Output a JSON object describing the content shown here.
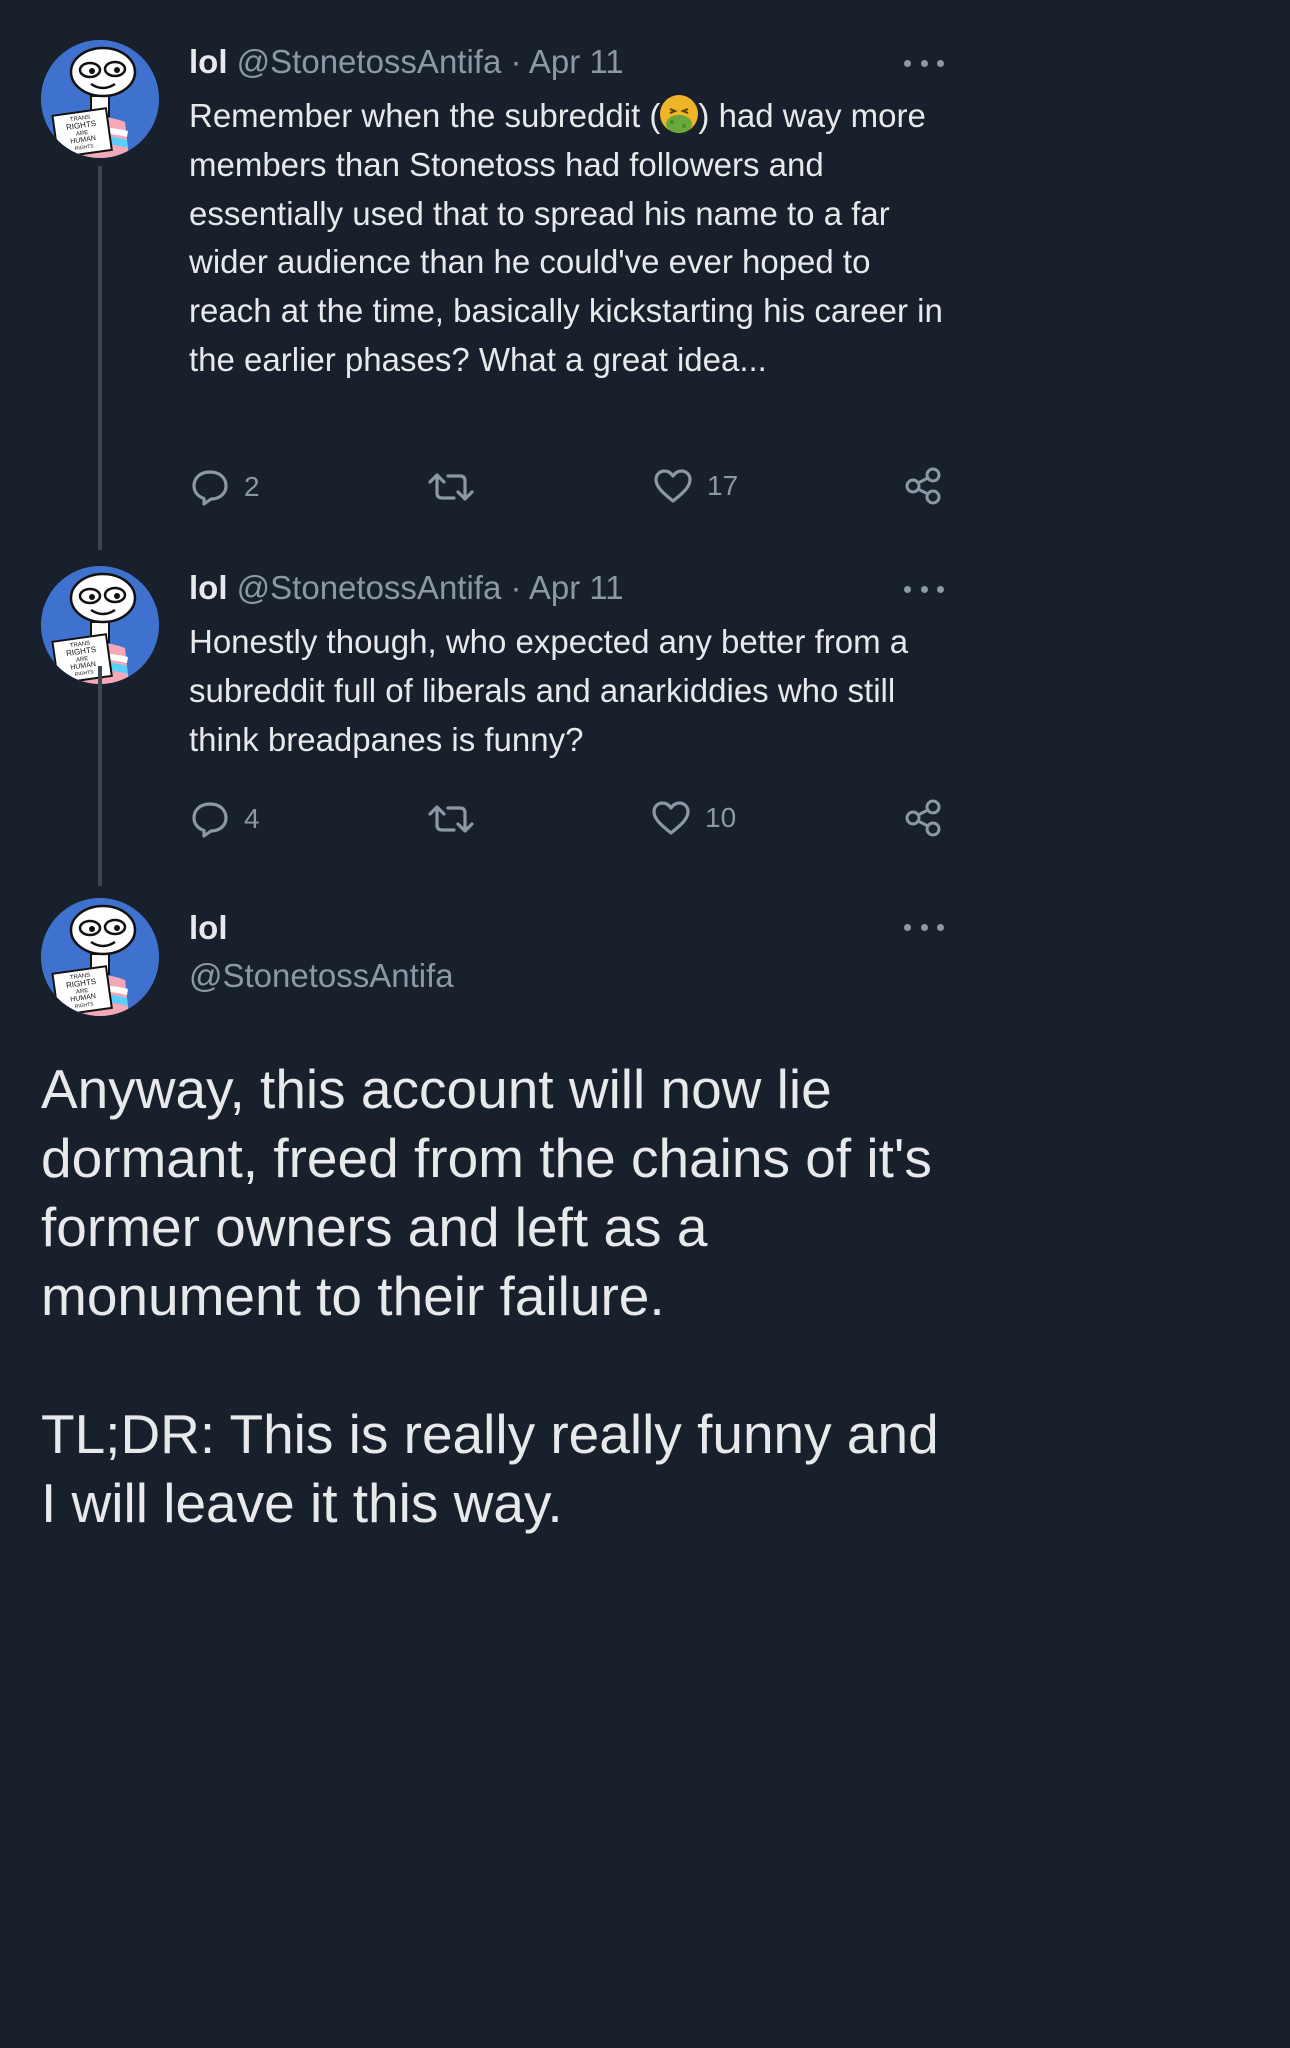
{
  "tweets": [
    {
      "name": "lol",
      "handle": "@StonetossAntifa",
      "separator": "·",
      "date": "Apr 11",
      "text_before_emoji": "Remember when the subreddit (",
      "text_after_emoji": ") had way more members than Stonetoss had followers and essentially used that to spread his name to a far wider audience than he could've ever hoped to reach at the time, basically kickstarting his career in the earlier phases? What a great idea...",
      "emoji": "nauseated-face-emoji",
      "replies": "2",
      "likes": "17"
    },
    {
      "name": "lol",
      "handle": "@StonetossAntifa",
      "separator": "·",
      "date": "Apr 11",
      "text": "Honestly though, who expected any better from a subreddit full of liberals and anarkiddies who still think breadpanes is funny?",
      "replies": "4",
      "likes": "10"
    }
  ],
  "main_tweet": {
    "name": "lol",
    "handle": "@StonetossAntifa",
    "text": "Anyway, this account will now lie dormant, freed from the chains of it's former owners and left as a monument to their failure.\n\nTL;DR: This is really really funny and I will leave it this way."
  },
  "avatar": {
    "sign_lines": [
      "TRANS",
      "RIGHTS",
      "ARE",
      "HUMAN",
      "RIGHTS"
    ]
  },
  "icons": {
    "reply": "reply-icon",
    "retweet": "retweet-icon",
    "like": "heart-icon",
    "share": "share-icon",
    "more": "more-icon"
  },
  "colors": {
    "background": "#18202b",
    "text": "#e7e9ea",
    "muted": "#8b98a5",
    "avatar": "#3f71cf"
  }
}
